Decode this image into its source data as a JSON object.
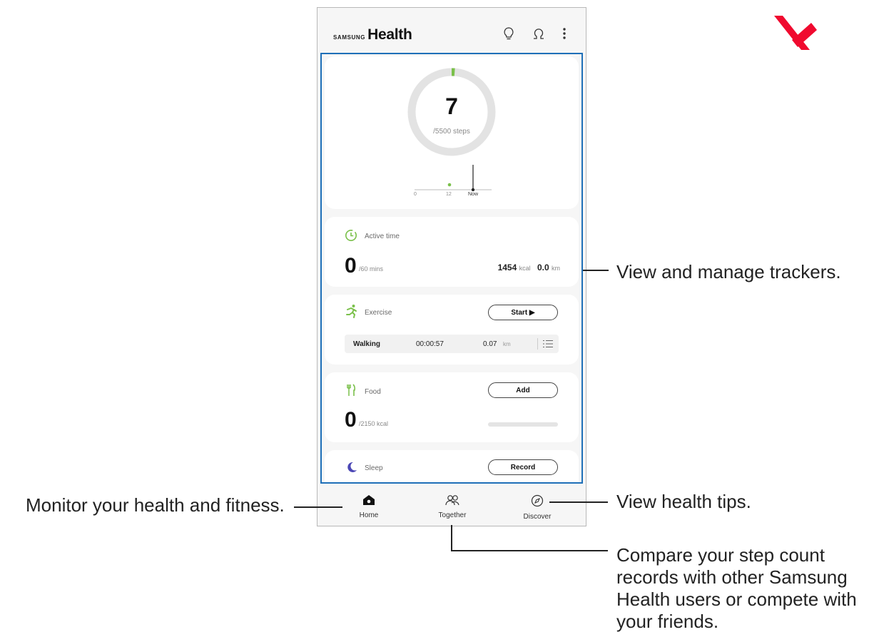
{
  "app": {
    "brand_small": "SAMSUNG",
    "brand_big": "Health"
  },
  "header_icons": [
    "lightbulb-icon",
    "profile-icon",
    "more-vert-icon"
  ],
  "steps": {
    "count": "7",
    "goal": "/5500 steps",
    "axis_start": "0",
    "axis_mid": "12",
    "axis_now": "Now",
    "progress": 0.0013
  },
  "active_time": {
    "title": "Active time",
    "value": "0",
    "goal": "/60 mins",
    "kcal_value": "1454",
    "kcal_unit": "kcal",
    "km_value": "0.0",
    "km_unit": "km"
  },
  "exercise": {
    "title": "Exercise",
    "button": "Start ▶",
    "row": {
      "type": "Walking",
      "duration": "00:00:57",
      "distance": "0.07",
      "unit": "km"
    }
  },
  "food": {
    "title": "Food",
    "button": "Add",
    "value": "0",
    "goal": "/2150 kcal"
  },
  "sleep": {
    "title": "Sleep",
    "button": "Record"
  },
  "nav": {
    "home": "Home",
    "together": "Together",
    "discover": "Discover"
  },
  "callouts": {
    "trackers": "View and manage trackers.",
    "tips": "View health tips.",
    "monitor": "Monitor your health and fitness.",
    "compare_lines": [
      "Compare your step count",
      "records with other Samsung",
      "Health users or compete with",
      "your friends."
    ]
  },
  "colors": {
    "accent_green": "#7ac04a",
    "highlight_blue": "#1e6fb8",
    "sleep_purple": "#4b47b5",
    "corner_mark": "#f00a2f"
  }
}
